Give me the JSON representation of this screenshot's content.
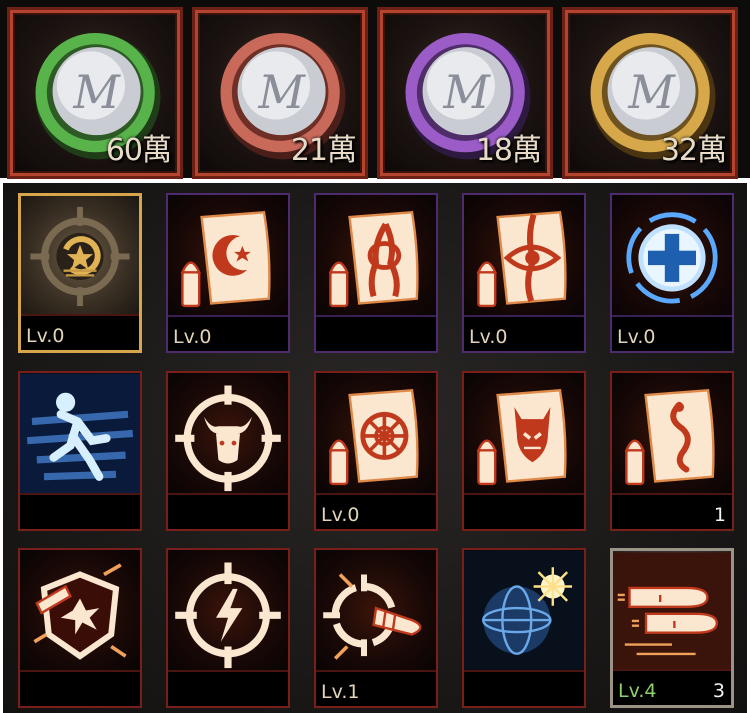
{
  "coins": [
    {
      "amount": "60萬",
      "ring": "#57b34a",
      "icon": "m-medal-coin-green-icon"
    },
    {
      "amount": "21萬",
      "ring": "#c8695a",
      "icon": "m-medal-coin-red-icon"
    },
    {
      "amount": "18萬",
      "ring": "#9b5cc8",
      "icon": "m-medal-coin-purple-icon"
    },
    {
      "amount": "32萬",
      "ring": "#d7a84a",
      "icon": "m-medal-coin-gold-icon"
    }
  ],
  "skills": [
    {
      "icon": "star-crosshair-badge-icon",
      "level": "Lv.0",
      "count": "",
      "frame": "gold"
    },
    {
      "icon": "crescent-star-scroll-ammo-icon",
      "level": "Lv.0",
      "count": "",
      "frame": "purple"
    },
    {
      "icon": "tentacle-scroll-ammo-icon",
      "level": "",
      "count": "",
      "frame": "purple"
    },
    {
      "icon": "eye-scroll-ammo-icon",
      "level": "Lv.0",
      "count": "",
      "frame": "purple"
    },
    {
      "icon": "medical-cross-icon",
      "level": "Lv.0",
      "count": "",
      "frame": "purple"
    },
    {
      "icon": "sprint-runner-icon",
      "level": "",
      "count": "",
      "frame": "red"
    },
    {
      "icon": "bull-crosshair-icon",
      "level": "",
      "count": "",
      "frame": "red"
    },
    {
      "icon": "wheel-scroll-ammo-icon",
      "level": "Lv.0",
      "count": "",
      "frame": "red"
    },
    {
      "icon": "demon-scroll-icon",
      "level": "",
      "count": "",
      "frame": "red"
    },
    {
      "icon": "swirl-scroll-ammo-icon",
      "level": "",
      "count": "1",
      "frame": "red"
    },
    {
      "icon": "shield-bullet-burst-icon",
      "level": "",
      "count": "",
      "frame": "red"
    },
    {
      "icon": "lightning-crosshair-icon",
      "level": "",
      "count": "",
      "frame": "red"
    },
    {
      "icon": "bullet-target-break-icon",
      "level": "Lv.1",
      "count": "",
      "frame": "red"
    },
    {
      "icon": "glowing-orb-icon",
      "level": "",
      "count": "",
      "frame": "red"
    },
    {
      "icon": "rapid-bullets-icon",
      "level": "Lv.4",
      "count": "3",
      "frame": "grey",
      "level_color": "#8fd06a"
    }
  ],
  "colors": {
    "accent_orange": "#f2a15a",
    "icon_fill": "#fbe7cf",
    "icon_blue": "#5aa9ff"
  }
}
